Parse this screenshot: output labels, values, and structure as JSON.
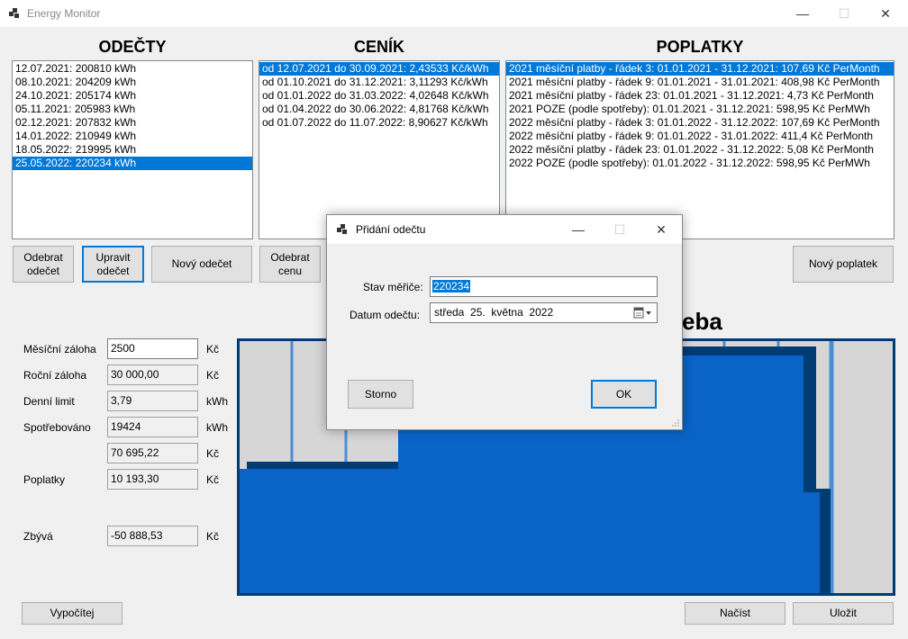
{
  "window": {
    "title": "Energy Monitor",
    "minimize": "—",
    "maximize": "☐",
    "close": "✕"
  },
  "odecty": {
    "title": "ODEČTY",
    "items": [
      "12.07.2021: 200810 kWh",
      "08.10.2021: 204209 kWh",
      "24.10.2021: 205174 kWh",
      "05.11.2021: 205983 kWh",
      "02.12.2021: 207832 kWh",
      "14.01.2022: 210949 kWh",
      "18.05.2022: 219995 kWh",
      "25.05.2022: 220234 kWh"
    ],
    "selected_index": 7,
    "remove_button": "Odebrat odečet",
    "edit_button": "Upravit odečet",
    "new_button": "Nový odečet"
  },
  "cenik": {
    "title": "CENÍK",
    "items": [
      "od 12.07.2021 do 30.09.2021: 2,43533 Kč/kWh",
      "od 01.10.2021 do 31.12.2021: 3,11293 Kč/kWh",
      "od 01.01.2022 do 31.03.2022: 4,02648 Kč/kWh",
      "od 01.04.2022 do 30.06.2022: 4,81768 Kč/kWh",
      "od 01.07.2022 do 11.07.2022: 8,90627 Kč/kWh"
    ],
    "selected_index": 0,
    "remove_button": "Odebrat cenu"
  },
  "poplatky": {
    "title": "POPLATKY",
    "items": [
      "2021 měsíční platby - řádek 3: 01.01.2021 - 31.12.2021: 107,69 Kč PerMonth",
      "2021 měsíční platby - řádek 9: 01.01.2021 - 31.01.2021: 408,98 Kč PerMonth",
      "2021 měsíční platby - řádek 23: 01.01.2021 - 31.12.2021: 4,73 Kč PerMonth",
      "2021 POZE (podle spotřeby): 01.01.2021 - 31.12.2021: 598,95 Kč PerMWh",
      "2022 měsíční platby - řádek 3: 01.01.2022 - 31.12.2022: 107,69 Kč PerMonth",
      "2022 měsíční platby - řádek 9: 01.01.2022 - 31.01.2022: 411,4 Kč PerMonth",
      "2022 měsíční platby - řádek 23: 01.01.2022 - 31.12.2022: 5,08 Kč PerMonth",
      "2022 POZE (podle spotřeby): 01.01.2022 - 31.12.2022: 598,95 Kč PerMWh"
    ],
    "selected_index": 0,
    "new_button": "Nový poplatek"
  },
  "summary": {
    "rows": [
      {
        "label": "Měsíční záloha",
        "value": "2500",
        "unit": "Kč",
        "editable": true
      },
      {
        "label": "Roční záloha",
        "value": "30 000,00",
        "unit": "Kč",
        "editable": false
      },
      {
        "label": "Denní limit",
        "value": "3,79",
        "unit": "kWh",
        "editable": false
      },
      {
        "label": "Spotřebováno",
        "value": "19424",
        "unit": "kWh",
        "editable": false
      },
      {
        "label": "",
        "value": "70 695,22",
        "unit": "Kč",
        "editable": false
      },
      {
        "label": "Poplatky",
        "value": "10 193,30",
        "unit": "Kč",
        "editable": false
      },
      {
        "label": "Zbývá",
        "value": "-50 888,53",
        "unit": "Kč",
        "editable": false
      }
    ]
  },
  "chart_heading_visible": "eba",
  "buttons": {
    "calculate": "Vypočítej",
    "load": "Načíst",
    "save": "Uložit"
  },
  "dialog": {
    "title": "Přidání odečtu",
    "meter_label": "Stav měřiče:",
    "meter_value": "220234",
    "date_label": "Datum odečtu:",
    "date_weekday": "středa",
    "date_day": "25.",
    "date_month": "května",
    "date_year": "2022",
    "cancel_button": "Storno",
    "ok_button": "OK"
  },
  "colors": {
    "accent": "#0078d7",
    "chart_fill": "#0a64c8",
    "chart_dark": "#003c74",
    "chart_line": "#4a8fd6",
    "chart_bg": "#d6d6d6"
  }
}
